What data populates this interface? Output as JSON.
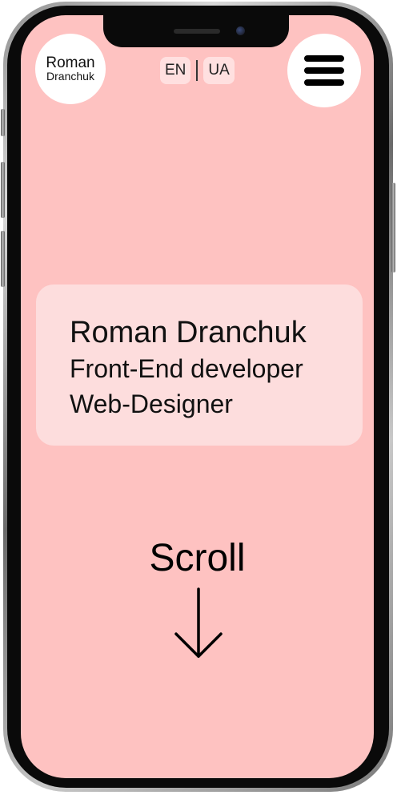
{
  "header": {
    "logo": {
      "line1": "Roman",
      "line2": "Dranchuk"
    },
    "languages": [
      {
        "code": "EN"
      },
      {
        "code": "UA"
      }
    ],
    "menu_icon": "hamburger-menu-icon"
  },
  "hero": {
    "name": "Roman Dranchuk",
    "role1": "Front-End developer",
    "role2": "Web-Designer"
  },
  "scroll": {
    "label": "Scroll",
    "icon": "arrow-down-icon"
  },
  "colors": {
    "background": "#fec2c1",
    "card": "#fddddd",
    "text": "#111111"
  }
}
